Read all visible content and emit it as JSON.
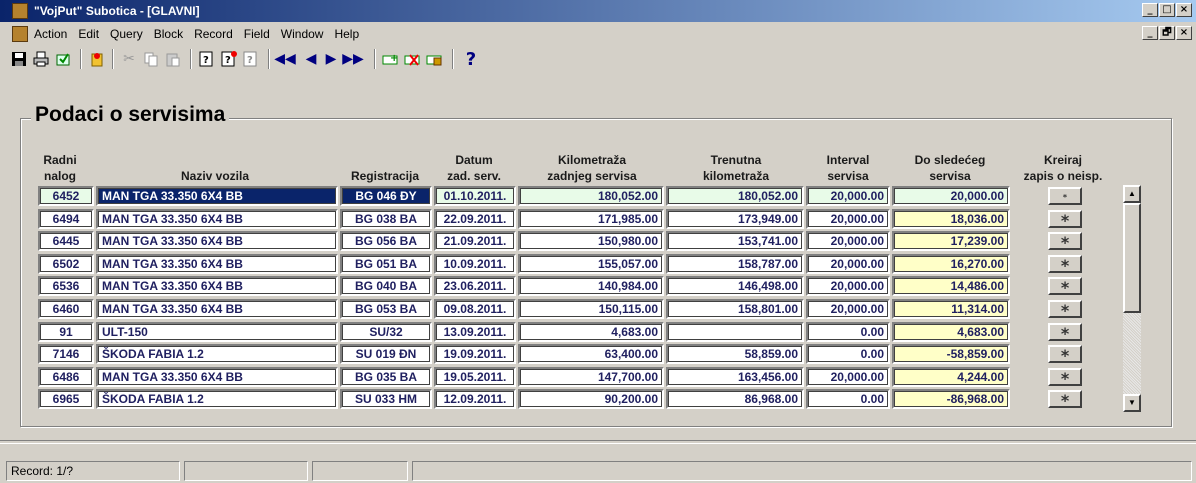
{
  "window": {
    "title": "\"VojPut\" Subotica - [GLAVNI]",
    "controls": [
      "_",
      "□",
      "×"
    ],
    "mdi_controls": [
      "_",
      "🗗",
      "×"
    ]
  },
  "menu": [
    "Action",
    "Edit",
    "Query",
    "Block",
    "Record",
    "Field",
    "Window",
    "Help"
  ],
  "toolbar": {
    "icons": [
      "save-icon",
      "print-icon",
      "exit-icon",
      "enter-query-icon",
      "cut-icon",
      "copy-icon",
      "paste-icon",
      "query-icon",
      "execute-query-icon",
      "cancel-query-icon",
      "first-record-icon",
      "previous-record-icon",
      "next-record-icon",
      "last-record-icon",
      "insert-record-icon",
      "delete-record-icon",
      "lock-record-icon",
      "help-icon"
    ],
    "help_glyph": "?"
  },
  "section_title": "Podaci o servisima",
  "headers": {
    "radni_nalog": "Radni\nnalog",
    "naziv_vozila": "Naziv vozila",
    "registracija": "Registracija",
    "datum": "Datum\nzad. serv.",
    "km_zadnjeg": "Kilometraža\nzadnjeg servisa",
    "trenutna_km": "Trenutna\nkilometraža",
    "interval": "Interval\nservisa",
    "do_sledeceg": "Do sledećeg\nservisa",
    "kreiraj": "Kreiraj\nzapis o neisp."
  },
  "rows": [
    {
      "nalog": "6452",
      "naziv": "MAN TGA 33.350 6X4 BB",
      "reg": "BG 046 ĐY",
      "datum": "01.10.2011.",
      "km_zad": "180,052.00",
      "km_tren": "180,052.00",
      "interval": "20,000.00",
      "do_sled": "20,000.00",
      "btn": "*"
    },
    {
      "nalog": "6494",
      "naziv": "MAN TGA 33.350 6X4 BB",
      "reg": "BG 038 BA",
      "datum": "22.09.2011.",
      "km_zad": "171,985.00",
      "km_tren": "173,949.00",
      "interval": "20,000.00",
      "do_sled": "18,036.00",
      "btn": "*"
    },
    {
      "nalog": "6445",
      "naziv": "MAN TGA 33.350 6X4 BB",
      "reg": "BG 056 BA",
      "datum": "21.09.2011.",
      "km_zad": "150,980.00",
      "km_tren": "153,741.00",
      "interval": "20,000.00",
      "do_sled": "17,239.00",
      "btn": "*"
    },
    {
      "nalog": "6502",
      "naziv": "MAN TGA 33.350 6X4 BB",
      "reg": "BG 051 BA",
      "datum": "10.09.2011.",
      "km_zad": "155,057.00",
      "km_tren": "158,787.00",
      "interval": "20,000.00",
      "do_sled": "16,270.00",
      "btn": "*"
    },
    {
      "nalog": "6536",
      "naziv": "MAN TGA 33.350 6X4 BB",
      "reg": "BG 040 BA",
      "datum": "23.06.2011.",
      "km_zad": "140,984.00",
      "km_tren": "146,498.00",
      "interval": "20,000.00",
      "do_sled": "14,486.00",
      "btn": "*"
    },
    {
      "nalog": "6460",
      "naziv": "MAN TGA 33.350 6X4 BB",
      "reg": "BG 053 BA",
      "datum": "09.08.2011.",
      "km_zad": "150,115.00",
      "km_tren": "158,801.00",
      "interval": "20,000.00",
      "do_sled": "11,314.00",
      "btn": "*"
    },
    {
      "nalog": "91",
      "naziv": "ULT-150",
      "reg": "SU/32",
      "datum": "13.09.2011.",
      "km_zad": "4,683.00",
      "km_tren": "",
      "interval": "0.00",
      "do_sled": "4,683.00",
      "btn": "*"
    },
    {
      "nalog": "7146",
      "naziv": "ŠKODA FABIA 1.2",
      "reg": "SU 019 ĐN",
      "datum": "19.09.2011.",
      "km_zad": "63,400.00",
      "km_tren": "58,859.00",
      "interval": "0.00",
      "do_sled": "-58,859.00",
      "btn": "*"
    },
    {
      "nalog": "6486",
      "naziv": "MAN TGA 33.350 6X4 BB",
      "reg": "BG 035 BA",
      "datum": "19.05.2011.",
      "km_zad": "147,700.00",
      "km_tren": "163,456.00",
      "interval": "20,000.00",
      "do_sled": "4,244.00",
      "btn": "*"
    },
    {
      "nalog": "6965",
      "naziv": "ŠKODA FABIA 1.2",
      "reg": "SU 033 HM",
      "datum": "12.09.2011.",
      "km_zad": "90,200.00",
      "km_tren": "86,968.00",
      "interval": "0.00",
      "do_sled": "-86,968.00",
      "btn": "*"
    }
  ],
  "scrollbar": {
    "up": "▲",
    "down": "▼"
  },
  "status": {
    "record": "Record: 1/?",
    "fields": [
      "",
      "",
      ""
    ]
  },
  "colors": {
    "selected": "#0a246a",
    "green_cell": "#e8fbe8",
    "yellow_cell": "#ffffc8"
  }
}
